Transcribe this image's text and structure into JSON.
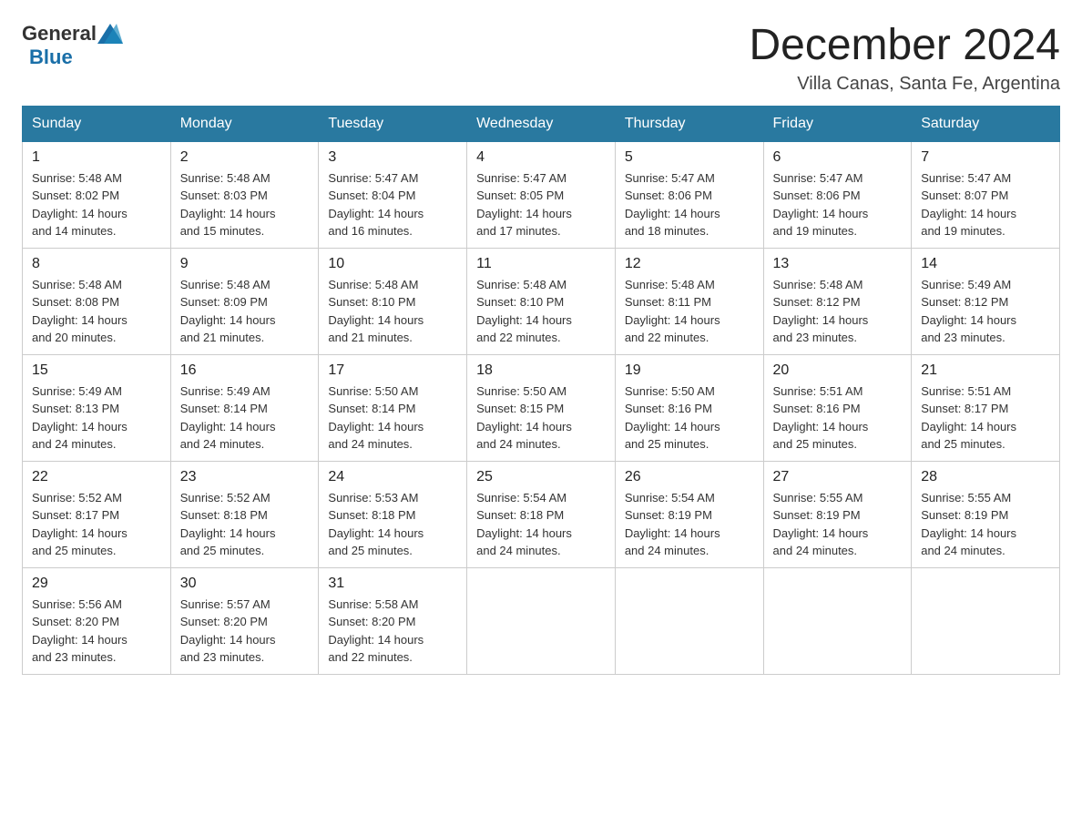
{
  "header": {
    "logo_general": "General",
    "logo_blue": "Blue",
    "title": "December 2024",
    "location": "Villa Canas, Santa Fe, Argentina"
  },
  "days_of_week": [
    "Sunday",
    "Monday",
    "Tuesday",
    "Wednesday",
    "Thursday",
    "Friday",
    "Saturday"
  ],
  "weeks": [
    [
      {
        "day": "1",
        "sunrise": "5:48 AM",
        "sunset": "8:02 PM",
        "daylight": "14 hours and 14 minutes."
      },
      {
        "day": "2",
        "sunrise": "5:48 AM",
        "sunset": "8:03 PM",
        "daylight": "14 hours and 15 minutes."
      },
      {
        "day": "3",
        "sunrise": "5:47 AM",
        "sunset": "8:04 PM",
        "daylight": "14 hours and 16 minutes."
      },
      {
        "day": "4",
        "sunrise": "5:47 AM",
        "sunset": "8:05 PM",
        "daylight": "14 hours and 17 minutes."
      },
      {
        "day": "5",
        "sunrise": "5:47 AM",
        "sunset": "8:06 PM",
        "daylight": "14 hours and 18 minutes."
      },
      {
        "day": "6",
        "sunrise": "5:47 AM",
        "sunset": "8:06 PM",
        "daylight": "14 hours and 19 minutes."
      },
      {
        "day": "7",
        "sunrise": "5:47 AM",
        "sunset": "8:07 PM",
        "daylight": "14 hours and 19 minutes."
      }
    ],
    [
      {
        "day": "8",
        "sunrise": "5:48 AM",
        "sunset": "8:08 PM",
        "daylight": "14 hours and 20 minutes."
      },
      {
        "day": "9",
        "sunrise": "5:48 AM",
        "sunset": "8:09 PM",
        "daylight": "14 hours and 21 minutes."
      },
      {
        "day": "10",
        "sunrise": "5:48 AM",
        "sunset": "8:10 PM",
        "daylight": "14 hours and 21 minutes."
      },
      {
        "day": "11",
        "sunrise": "5:48 AM",
        "sunset": "8:10 PM",
        "daylight": "14 hours and 22 minutes."
      },
      {
        "day": "12",
        "sunrise": "5:48 AM",
        "sunset": "8:11 PM",
        "daylight": "14 hours and 22 minutes."
      },
      {
        "day": "13",
        "sunrise": "5:48 AM",
        "sunset": "8:12 PM",
        "daylight": "14 hours and 23 minutes."
      },
      {
        "day": "14",
        "sunrise": "5:49 AM",
        "sunset": "8:12 PM",
        "daylight": "14 hours and 23 minutes."
      }
    ],
    [
      {
        "day": "15",
        "sunrise": "5:49 AM",
        "sunset": "8:13 PM",
        "daylight": "14 hours and 24 minutes."
      },
      {
        "day": "16",
        "sunrise": "5:49 AM",
        "sunset": "8:14 PM",
        "daylight": "14 hours and 24 minutes."
      },
      {
        "day": "17",
        "sunrise": "5:50 AM",
        "sunset": "8:14 PM",
        "daylight": "14 hours and 24 minutes."
      },
      {
        "day": "18",
        "sunrise": "5:50 AM",
        "sunset": "8:15 PM",
        "daylight": "14 hours and 24 minutes."
      },
      {
        "day": "19",
        "sunrise": "5:50 AM",
        "sunset": "8:16 PM",
        "daylight": "14 hours and 25 minutes."
      },
      {
        "day": "20",
        "sunrise": "5:51 AM",
        "sunset": "8:16 PM",
        "daylight": "14 hours and 25 minutes."
      },
      {
        "day": "21",
        "sunrise": "5:51 AM",
        "sunset": "8:17 PM",
        "daylight": "14 hours and 25 minutes."
      }
    ],
    [
      {
        "day": "22",
        "sunrise": "5:52 AM",
        "sunset": "8:17 PM",
        "daylight": "14 hours and 25 minutes."
      },
      {
        "day": "23",
        "sunrise": "5:52 AM",
        "sunset": "8:18 PM",
        "daylight": "14 hours and 25 minutes."
      },
      {
        "day": "24",
        "sunrise": "5:53 AM",
        "sunset": "8:18 PM",
        "daylight": "14 hours and 25 minutes."
      },
      {
        "day": "25",
        "sunrise": "5:54 AM",
        "sunset": "8:18 PM",
        "daylight": "14 hours and 24 minutes."
      },
      {
        "day": "26",
        "sunrise": "5:54 AM",
        "sunset": "8:19 PM",
        "daylight": "14 hours and 24 minutes."
      },
      {
        "day": "27",
        "sunrise": "5:55 AM",
        "sunset": "8:19 PM",
        "daylight": "14 hours and 24 minutes."
      },
      {
        "day": "28",
        "sunrise": "5:55 AM",
        "sunset": "8:19 PM",
        "daylight": "14 hours and 24 minutes."
      }
    ],
    [
      {
        "day": "29",
        "sunrise": "5:56 AM",
        "sunset": "8:20 PM",
        "daylight": "14 hours and 23 minutes."
      },
      {
        "day": "30",
        "sunrise": "5:57 AM",
        "sunset": "8:20 PM",
        "daylight": "14 hours and 23 minutes."
      },
      {
        "day": "31",
        "sunrise": "5:58 AM",
        "sunset": "8:20 PM",
        "daylight": "14 hours and 22 minutes."
      },
      null,
      null,
      null,
      null
    ]
  ],
  "labels": {
    "sunrise": "Sunrise:",
    "sunset": "Sunset:",
    "daylight": "Daylight:"
  }
}
